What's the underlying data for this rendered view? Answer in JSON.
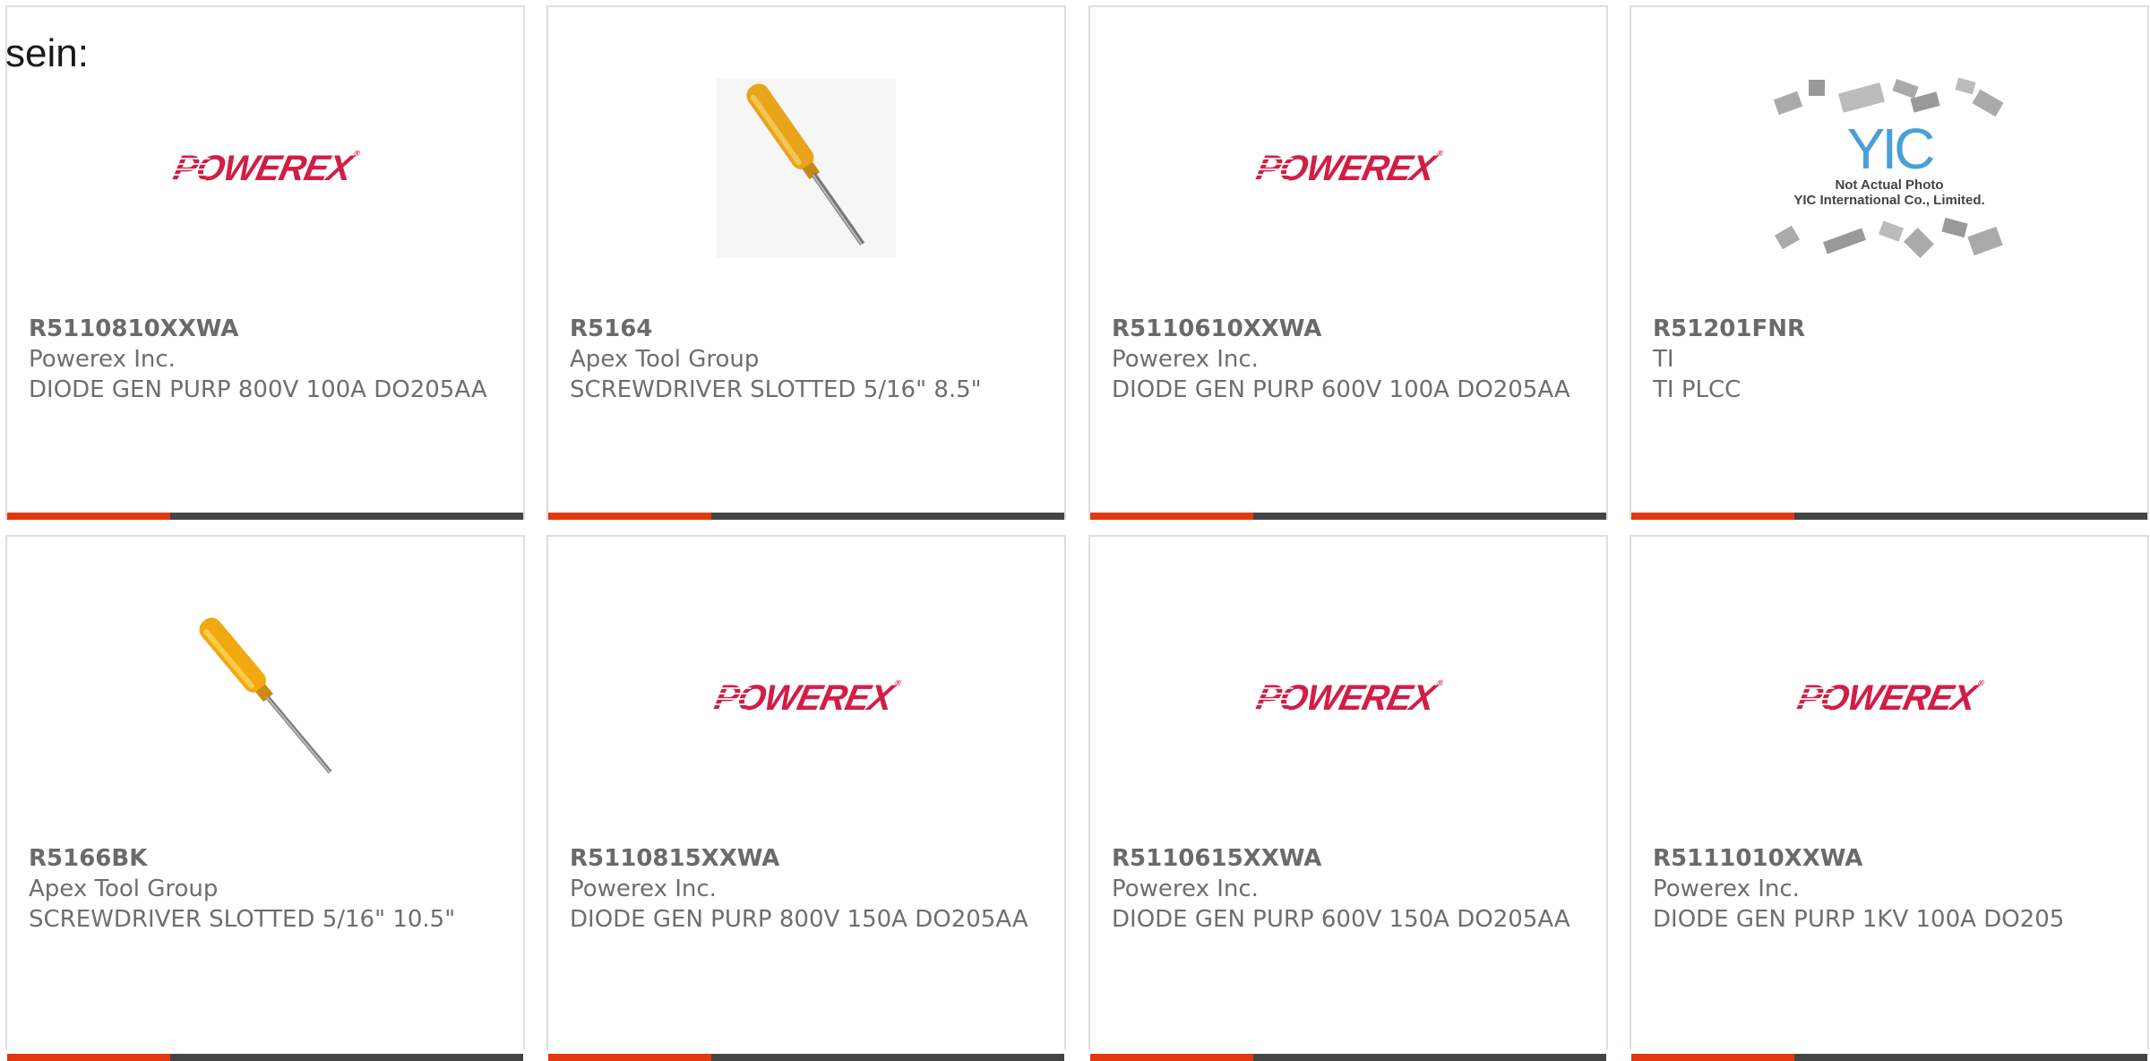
{
  "page": {
    "intro_text": "sein:"
  },
  "colors": {
    "accent_bar": "#e2370f",
    "dark_bar": "#444444",
    "powerex_red": "#d21e46",
    "text_gray": "#6e6e6e"
  },
  "logos": {
    "powerex": "POWEREX",
    "yic_mark": "YIC",
    "yic_line1": "Not Actual Photo",
    "yic_line2": "YIC International Co., Limited."
  },
  "products": [
    {
      "part_number": "R5110810XXWA",
      "manufacturer": "Powerex Inc.",
      "description": "DIODE GEN PURP 800V 100A DO205AA",
      "image": "powerex-logo"
    },
    {
      "part_number": "R5164",
      "manufacturer": "Apex Tool Group",
      "description": "SCREWDRIVER SLOTTED 5/16\" 8.5\"",
      "image": "screwdriver-photo"
    },
    {
      "part_number": "R5110610XXWA",
      "manufacturer": "Powerex Inc.",
      "description": "DIODE GEN PURP 600V 100A DO205AA",
      "image": "powerex-logo"
    },
    {
      "part_number": "R51201FNR",
      "manufacturer": "TI",
      "description": "TI PLCC",
      "image": "yic-placeholder"
    },
    {
      "part_number": "R5166BK",
      "manufacturer": "Apex Tool Group",
      "description": "SCREWDRIVER SLOTTED 5/16\" 10.5\"",
      "image": "screwdriver-photo"
    },
    {
      "part_number": "R5110815XXWA",
      "manufacturer": "Powerex Inc.",
      "description": "DIODE GEN PURP 800V 150A DO205AA",
      "image": "powerex-logo"
    },
    {
      "part_number": "R5110615XXWA",
      "manufacturer": "Powerex Inc.",
      "description": "DIODE GEN PURP 600V 150A DO205AA",
      "image": "powerex-logo"
    },
    {
      "part_number": "R5111010XXWA",
      "manufacturer": "Powerex Inc.",
      "description": "DIODE GEN PURP 1KV 100A DO205",
      "image": "powerex-logo"
    }
  ]
}
